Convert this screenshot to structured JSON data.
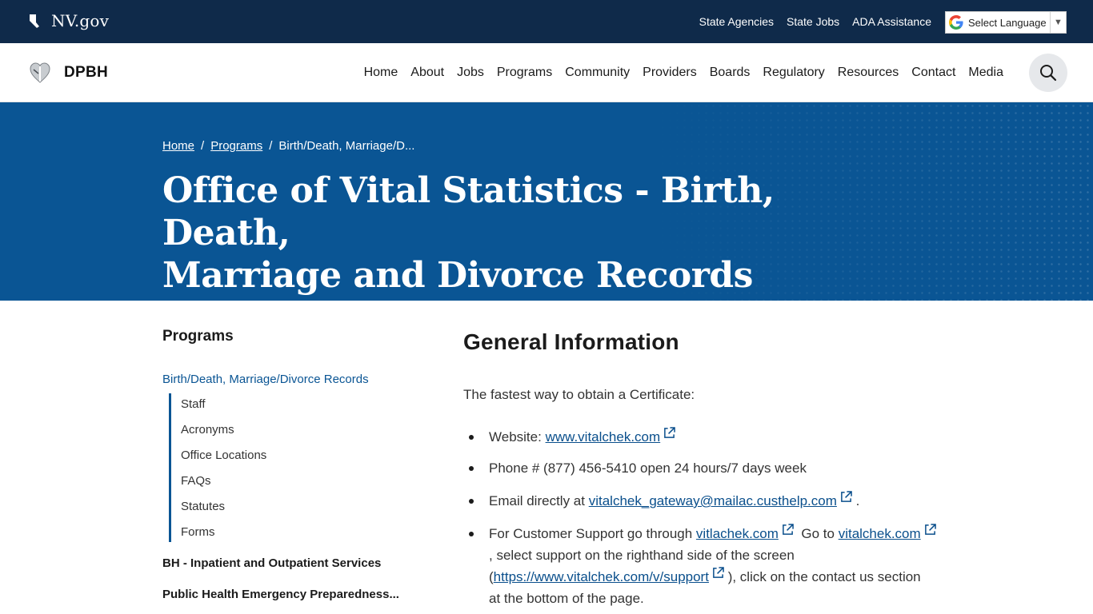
{
  "topbar": {
    "logo_text": "NV.gov",
    "links": [
      "State Agencies",
      "State Jobs",
      "ADA Assistance"
    ],
    "language_label": "Select Language"
  },
  "navbar": {
    "brand": "DPBH",
    "items": [
      "Home",
      "About",
      "Jobs",
      "Programs",
      "Community",
      "Providers",
      "Boards",
      "Regulatory",
      "Resources",
      "Contact",
      "Media"
    ]
  },
  "hero": {
    "breadcrumb": {
      "home": "Home",
      "programs": "Programs",
      "current": "Birth/Death, Marriage/D...",
      "sep": "/"
    },
    "title_line1": "Office of Vital Statistics - Birth, Death,",
    "title_line2": "Marriage and Divorce Records"
  },
  "sidebar": {
    "heading": "Programs",
    "active": "Birth/Death, Marriage/Divorce Records",
    "subitems": [
      "Staff",
      "Acronyms",
      "Office Locations",
      "FAQs",
      "Statutes",
      "Forms"
    ],
    "others": [
      "BH - Inpatient and Outpatient Services",
      "Public Health Emergency Preparedness..."
    ]
  },
  "content": {
    "heading": "General Information",
    "intro": "The fastest way to obtain a Certificate:",
    "b1_prefix": "Website:",
    "b1_link": "www.vitalchek.com",
    "b2_text": "Phone # (877) 456-5410 open 24 hours/7 days week",
    "b3_prefix": "Email directly at",
    "b3_link": "vitalchek_gateway@mailac.custhelp.com",
    "b3_suffix": ".",
    "b4_prefix": "For Customer Support go through",
    "b4_link1": "vitlachek.com",
    "b4_mid": "Go to",
    "b4_link2": "vitalchek.com",
    "b4_line2": ", select support on the righthand side of the screen",
    "b4_open": "(",
    "b4_link3": "https://www.vitalchek.com/v/support",
    "b4_line3": "), click on the contact us section",
    "b4_line4": "at the bottom of the page."
  },
  "colors": {
    "topbar": "#0f2a4a",
    "hero": "#0a5594",
    "link": "#0a4f8c"
  }
}
